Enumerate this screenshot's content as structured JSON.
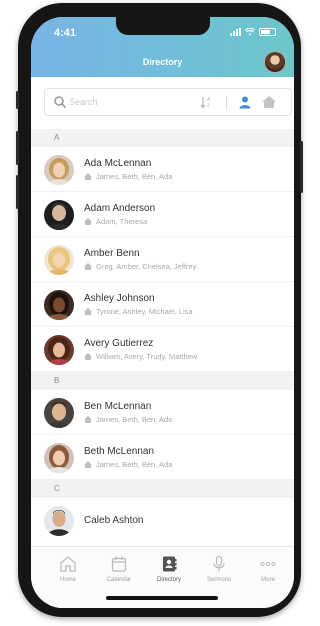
{
  "status_bar": {
    "time": "4:41"
  },
  "header": {
    "title": "Directory"
  },
  "search": {
    "placeholder": "Search"
  },
  "sections": [
    {
      "letter": "A",
      "contacts": [
        {
          "name": "Ada McLennan",
          "family": "James, Beth, Ben, Ada"
        },
        {
          "name": "Adam Anderson",
          "family": "Adam, Theresa"
        },
        {
          "name": "Amber Benn",
          "family": "Greg, Amber, Chelsea, Jeffrey"
        },
        {
          "name": "Ashley Johnson",
          "family": "Tyrone, Ashley, Michael, Lisa"
        },
        {
          "name": "Avery Gutierrez",
          "family": "William, Avery, Trudy, Matthew"
        }
      ]
    },
    {
      "letter": "B",
      "contacts": [
        {
          "name": "Ben McLennan",
          "family": "James, Beth, Ben, Ada"
        },
        {
          "name": "Beth McLennan",
          "family": "James, Beth, Ben, Ada"
        }
      ]
    },
    {
      "letter": "C",
      "contacts": [
        {
          "name": "Caleb Ashton",
          "family": ""
        }
      ]
    }
  ],
  "tabs": [
    {
      "label": "Home",
      "icon": "home-icon",
      "active": false
    },
    {
      "label": "Calendar",
      "icon": "calendar-icon",
      "active": false
    },
    {
      "label": "Directory",
      "icon": "directory-icon",
      "active": true
    },
    {
      "label": "Sermons",
      "icon": "microphone-icon",
      "active": false
    },
    {
      "label": "More",
      "icon": "more-icon",
      "active": false
    }
  ],
  "colors": {
    "header_gradient_start": "#78b4e6",
    "header_gradient_end": "#6dc7c9",
    "accent_blue": "#3f8fd8",
    "section_bg": "#f2f2f2"
  }
}
